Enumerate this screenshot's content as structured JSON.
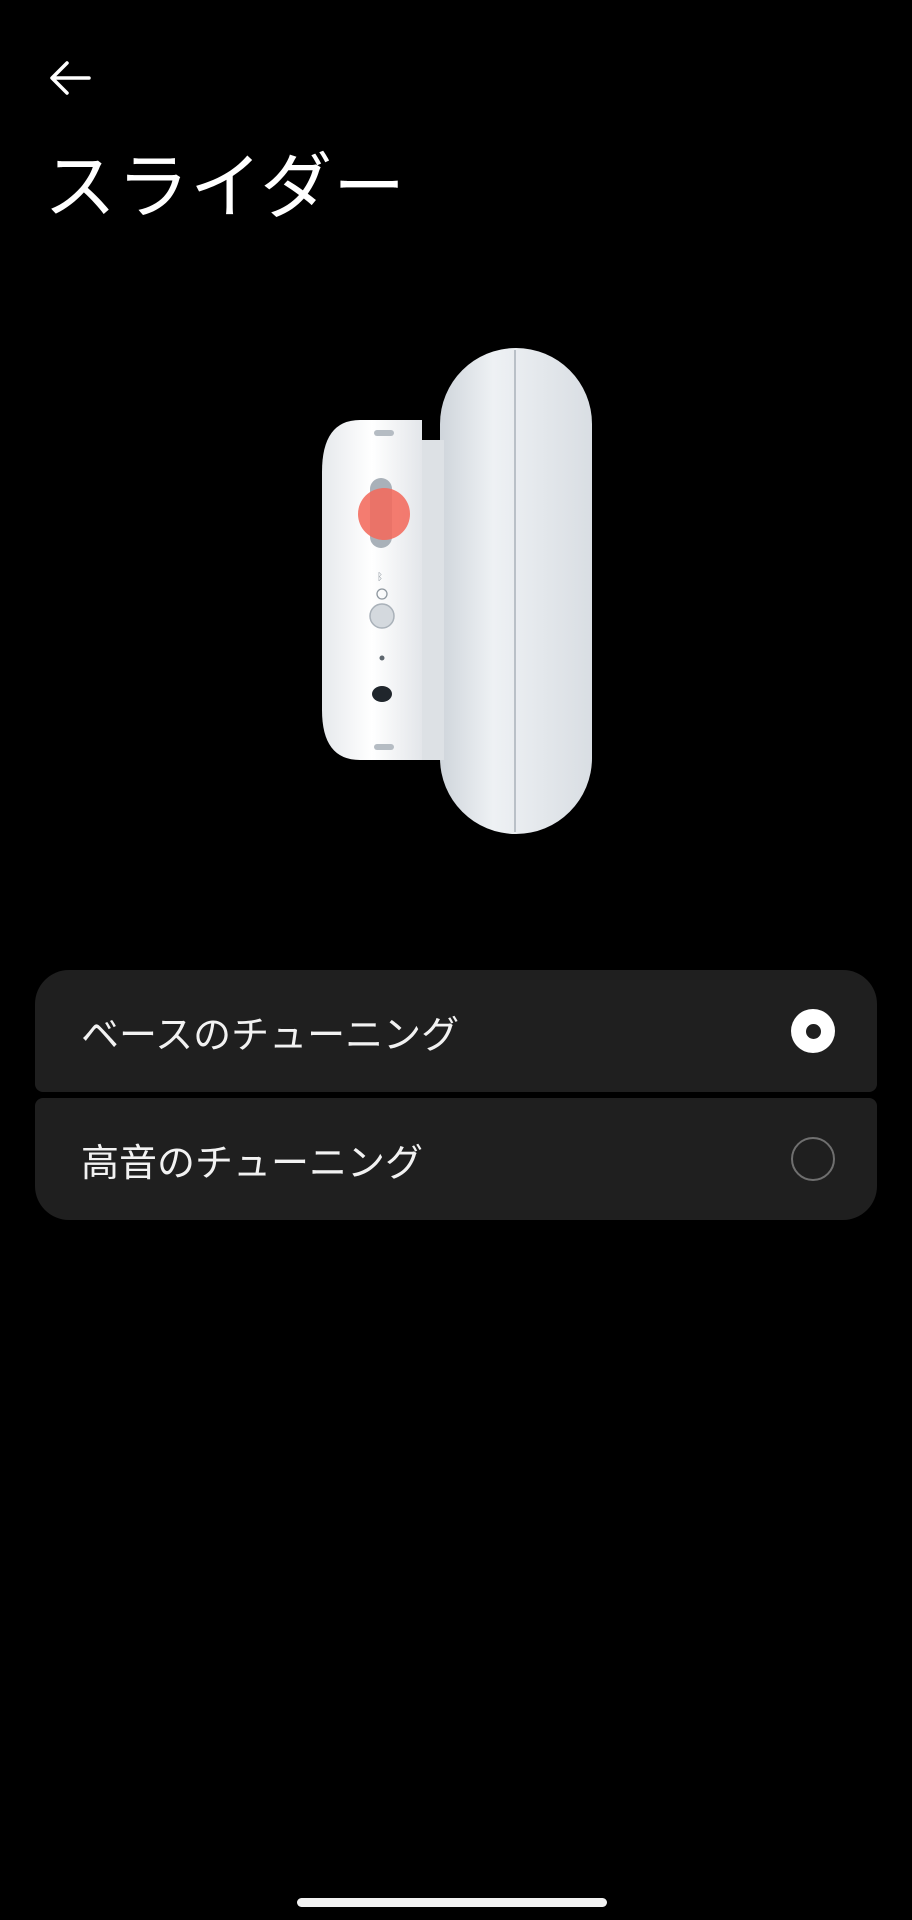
{
  "header": {
    "back_icon": "arrow-left-icon",
    "title": "スライダー"
  },
  "illustration": {
    "subject": "headphone-earcup-side-view",
    "highlight_color": "#f26a5c",
    "device_color": "#e8ebee"
  },
  "options": [
    {
      "label": "ベースのチューニング",
      "selected": true
    },
    {
      "label": "高音のチューニング",
      "selected": false
    }
  ],
  "colors": {
    "background": "#000000",
    "row_background": "#1f1f1f",
    "text": "#f2f2f2",
    "radio_unchecked_border": "#6f6f6f"
  }
}
